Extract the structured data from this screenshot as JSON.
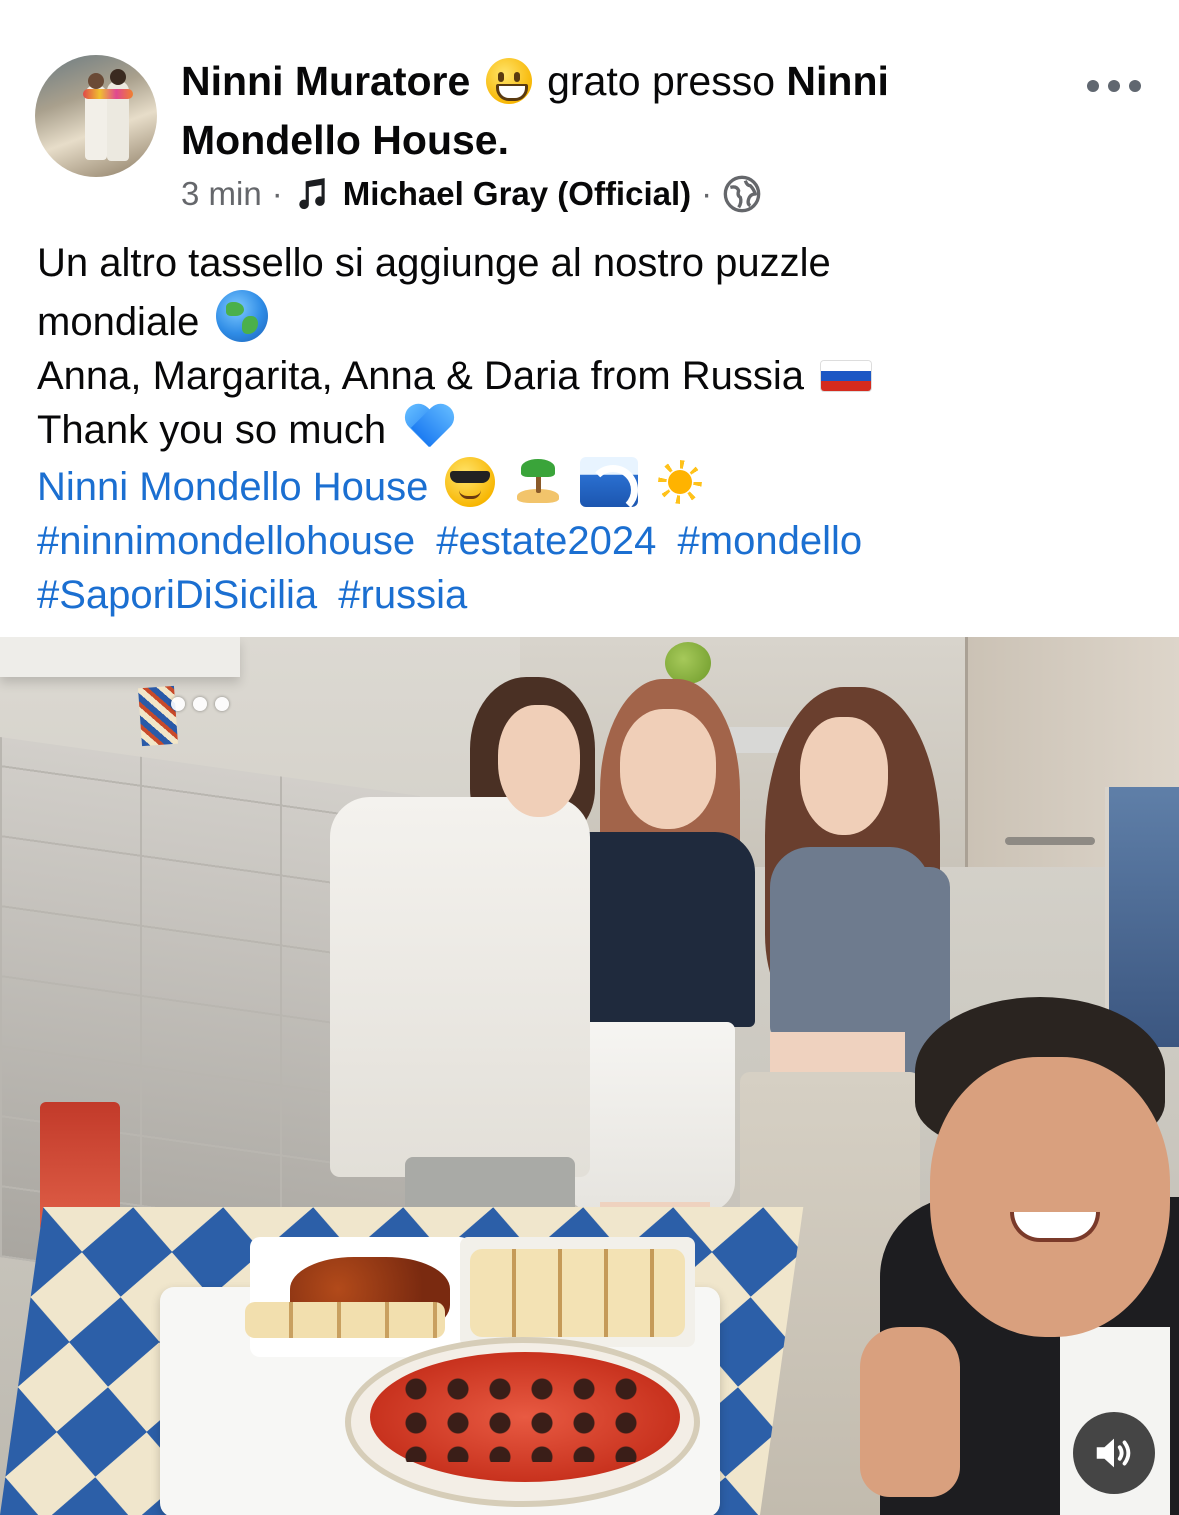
{
  "post": {
    "author_name": "Ninni Muratore",
    "activity_text": "grato presso",
    "activity_emoji": "grinning-face",
    "place_name": "Ninni Mondello House.",
    "timestamp": "3 min",
    "music_label": "Michael Gray (Official)",
    "privacy_icon": "globe-icon",
    "text_lines": [
      "Un altro tassello si aggiunge al nostro puzzle",
      "mondiale",
      "Anna, Margarita, Anna & Daria from Russia",
      "Thank you so much"
    ],
    "page_link": "Ninni Mondello House",
    "hashtags_line1": [
      "#ninnimondellohouse",
      "#estate2024",
      "#mondello"
    ],
    "hashtags_line2": [
      "#SaporiDiSicilia",
      "#russia"
    ]
  },
  "media": {
    "carousel_indicator": "•••",
    "sound_icon": "speaker-icon"
  },
  "colors": {
    "link": "#1b6fd1",
    "meta_text": "#65676b",
    "primary_text": "#080809"
  }
}
